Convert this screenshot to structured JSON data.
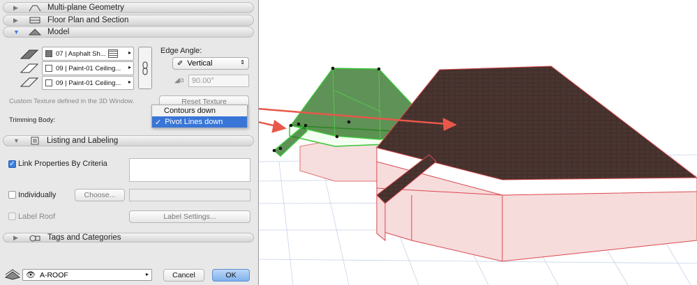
{
  "sections": {
    "multiplane": "Multi-plane Geometry",
    "floorplan": "Floor Plan and Section",
    "model": "Model",
    "listing": "Listing and Labeling",
    "tags": "Tags and Categories"
  },
  "model": {
    "materials": [
      {
        "label": "07 | Asphalt Sh...",
        "chip": "#777777"
      },
      {
        "label": "09 | Paint-01 Ceiling...",
        "chip": "#ffffff"
      },
      {
        "label": "09 | Paint-01 Ceiling...",
        "chip": "#ffffff"
      }
    ],
    "edge_angle_label": "Edge Angle:",
    "edge_angle_value": "Vertical",
    "angle_value": "90.00°",
    "custom_texture_text": "Custom Texture defined in the 3D Window.",
    "reset_texture": "Reset Texture",
    "trimming_body_label": "Trimming Body:",
    "trimming_options": [
      "Contours down",
      "Pivot Lines down"
    ],
    "selected_option": "Pivot Lines down",
    "check_mark": "✓"
  },
  "listing": {
    "link_properties": "Link Properties By Criteria",
    "individually": "Individually",
    "choose": "Choose...",
    "label_roof": "Label Roof",
    "label_settings": "Label Settings..."
  },
  "footer": {
    "layer": "A-ROOF",
    "cancel": "Cancel",
    "ok": "OK"
  },
  "colors": {
    "accent": "#3875d7",
    "roof": "#4a3530",
    "selected_roof": "#2a6e1e",
    "trim_arrow": "#e8584a"
  }
}
